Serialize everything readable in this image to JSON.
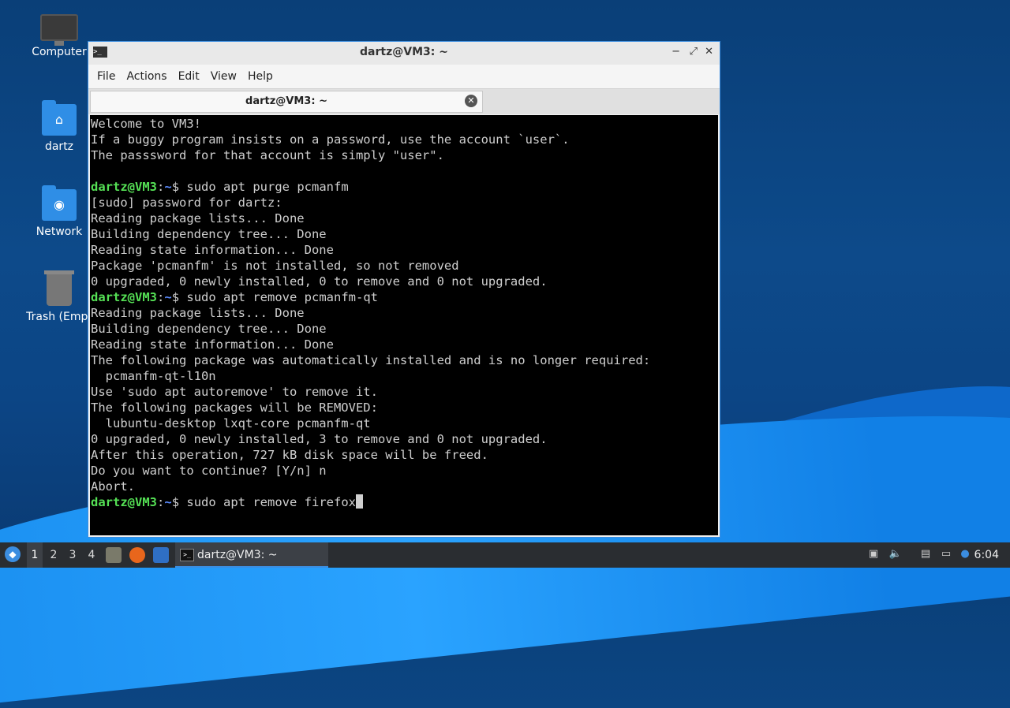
{
  "desktop": {
    "icons": [
      {
        "label": "Computer",
        "icon": "computer-icon"
      },
      {
        "label": "dartz",
        "icon": "home-folder-icon"
      },
      {
        "label": "Network",
        "icon": "network-folder-icon"
      },
      {
        "label": "Trash (Empt",
        "icon": "trash-icon"
      }
    ]
  },
  "window": {
    "title": "dartz@VM3: ~",
    "controls": {
      "minimize": "−",
      "maximize": "⤢",
      "close": "✕"
    },
    "menu": [
      "File",
      "Actions",
      "Edit",
      "View",
      "Help"
    ],
    "tab": {
      "label": "dartz@VM3: ~",
      "close": "✕"
    }
  },
  "terminal": {
    "prompt_user": "dartz@VM3",
    "prompt_sep": ":",
    "prompt_path": "~",
    "prompt_end": "$ ",
    "lines": [
      {
        "text": "Welcome to VM3!"
      },
      {
        "text": "If a buggy program insists on a password, use the account `user`."
      },
      {
        "text": "The passsword for that account is simply \"user\"."
      },
      {
        "text": ""
      },
      {
        "cmd": "sudo apt purge pcmanfm"
      },
      {
        "text": "[sudo] password for dartz:"
      },
      {
        "text": "Reading package lists... Done"
      },
      {
        "text": "Building dependency tree... Done"
      },
      {
        "text": "Reading state information... Done"
      },
      {
        "text": "Package 'pcmanfm' is not installed, so not removed"
      },
      {
        "text": "0 upgraded, 0 newly installed, 0 to remove and 0 not upgraded."
      },
      {
        "cmd": "sudo apt remove pcmanfm-qt"
      },
      {
        "text": "Reading package lists... Done"
      },
      {
        "text": "Building dependency tree... Done"
      },
      {
        "text": "Reading state information... Done"
      },
      {
        "text": "The following package was automatically installed and is no longer required:"
      },
      {
        "text": "  pcmanfm-qt-l10n"
      },
      {
        "text": "Use 'sudo apt autoremove' to remove it."
      },
      {
        "text": "The following packages will be REMOVED:"
      },
      {
        "text": "  lubuntu-desktop lxqt-core pcmanfm-qt"
      },
      {
        "text": "0 upgraded, 0 newly installed, 3 to remove and 0 not upgraded."
      },
      {
        "text": "After this operation, 727 kB disk space will be freed."
      },
      {
        "text": "Do you want to continue? [Y/n] n"
      },
      {
        "text": "Abort."
      },
      {
        "cmd": "sudo apt remove firefox",
        "cursor": true
      }
    ]
  },
  "taskbar": {
    "workspaces": [
      "1",
      "2",
      "3",
      "4"
    ],
    "active_workspace": 0,
    "task_label": "dartz@VM3: ~",
    "clock": "6:04"
  }
}
